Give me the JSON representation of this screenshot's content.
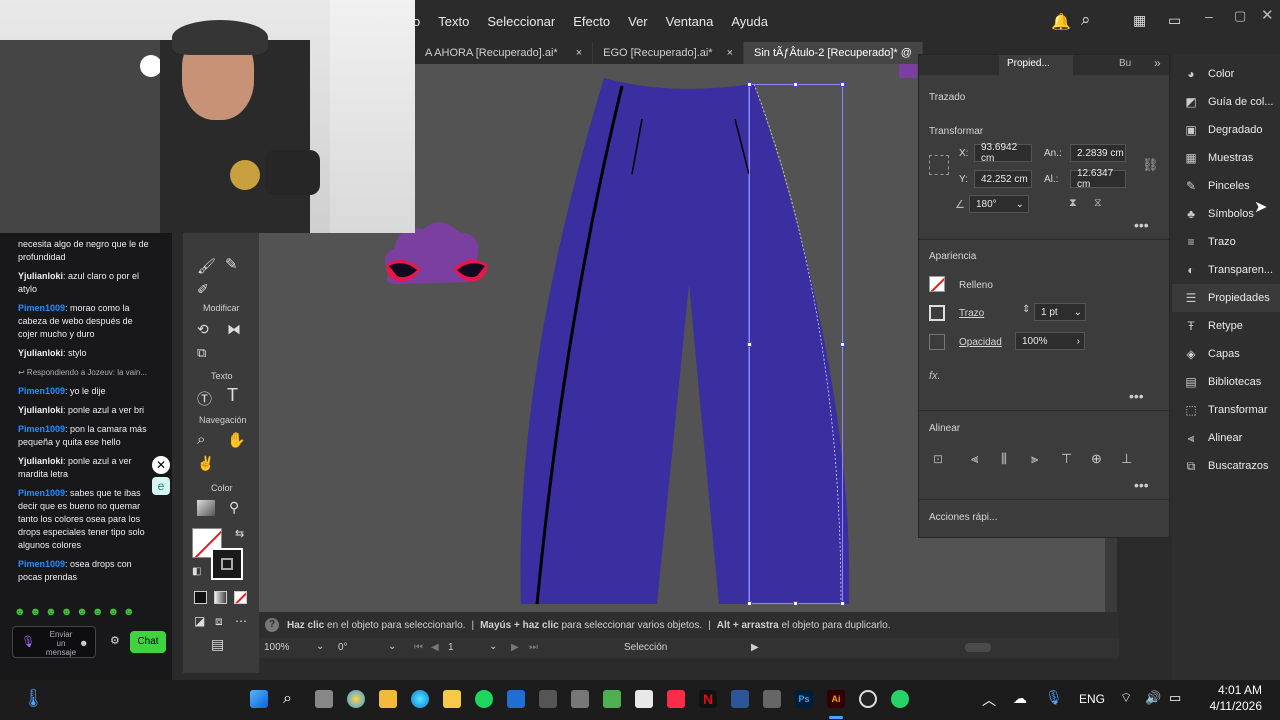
{
  "menu": [
    "o",
    "Texto",
    "Seleccionar",
    "Efecto",
    "Ver",
    "Ventana",
    "Ayuda"
  ],
  "tabs": [
    {
      "label": "A AHORA [Recuperado].ai*",
      "close": "×"
    },
    {
      "label": "EGO [Recuperado].ai*",
      "close": "×"
    },
    {
      "label": "Sin tÃƒÂtulo-2 [Recuperado]* @",
      "close": ""
    }
  ],
  "chat": {
    "messages": [
      {
        "user": "",
        "text": "necesita algo de negro que le de profundidad"
      },
      {
        "user": "Yjulianloki",
        "text": ": azul claro o por el atylo"
      },
      {
        "user": "Pimen1009",
        "text": ": morao como la cabeza de webo después de cojer mucho y duro"
      },
      {
        "user": "Yjulianloki",
        "text": ": stylo"
      },
      {
        "user": "",
        "text": "↩ Respondiendo a Jozeuv: la vain..."
      },
      {
        "user": "Pimen1009",
        "text": ": yo le dije"
      },
      {
        "user": "Yjulianloki",
        "text": ": ponle azul a ver bri"
      },
      {
        "user": "Pimen1009",
        "text": ": pon la camara más pequeña y quita ese hello"
      },
      {
        "user": "Yjulianloki",
        "text": ": ponle azul a ver mardita letra"
      },
      {
        "user": "Pimen1009",
        "text": ": sabes que te ibas decir que es bueno no quemar tanto los colores osea para los drops especiales tener tipo solo algunos colores"
      },
      {
        "user": "Pimen1009",
        "text": ": osea drops con pocas prendas"
      }
    ],
    "input_placeholder": "Enviar un mensaje",
    "chat_button": "Chat"
  },
  "tools": {
    "sections": [
      "Modificar",
      "Texto",
      "Navegación",
      "Color"
    ]
  },
  "properties": {
    "tab_label": "Propied...",
    "tab_bu": "Bu",
    "section_trazado": "Trazado",
    "section_transformar": "Transformar",
    "x_label": "X:",
    "x_value": "93.6942 cm",
    "y_label": "Y:",
    "y_value": "42.252 cm",
    "w_label": "An.:",
    "w_value": "2.2839 cm",
    "h_label": "Al.:",
    "h_value": "12.6347 cm",
    "angle_value": "180°",
    "section_apariencia": "Apariencia",
    "relleno": "Relleno",
    "trazo": "Trazo",
    "trazo_value": "1 pt",
    "opacidad": "Opacidad",
    "opacidad_value": "100%",
    "fx": "fx.",
    "section_alinear": "Alinear",
    "acciones": "Acciones rápi..."
  },
  "right_panel": [
    {
      "label": "Color",
      "icon": "palette-icon"
    },
    {
      "label": "Guía de col...",
      "icon": "color-guide-icon"
    },
    {
      "label": "Degradado",
      "icon": "gradient-icon"
    },
    {
      "label": "Muestras",
      "icon": "swatches-icon"
    },
    {
      "label": "Pinceles",
      "icon": "brush-icon"
    },
    {
      "label": "Símbolos",
      "icon": "symbols-icon"
    },
    {
      "label": "Trazo",
      "icon": "stroke-icon"
    },
    {
      "label": "Transparen...",
      "icon": "transparency-icon"
    },
    {
      "label": "Propiedades",
      "icon": "properties-icon"
    },
    {
      "label": "Retype",
      "icon": "retype-icon"
    },
    {
      "label": "Capas",
      "icon": "layers-icon"
    },
    {
      "label": "Bibliotecas",
      "icon": "libraries-icon"
    },
    {
      "label": "Transformar",
      "icon": "transform-icon"
    },
    {
      "label": "Alinear",
      "icon": "align-icon"
    },
    {
      "label": "Buscatrazos",
      "icon": "pathfinder-icon"
    }
  ],
  "hint": {
    "p1b": "Haz clic",
    "p1": " en el objeto para seleccionarlo.",
    "sep": "|",
    "p2b": "Mayús + haz clic",
    "p2": " para seleccionar varios objetos.",
    "p3b": "Alt + arrastra",
    "p3": " el objeto para duplicarlo."
  },
  "status": {
    "zoom": "100%",
    "rotation": "0°",
    "artboard": "1",
    "tool": "Selección"
  },
  "taskbar": {
    "lang": "ENG",
    "time": "4:01 AM",
    "date": "4/11/2026"
  },
  "colors": {
    "pants": "#3a2ea0",
    "pants_dark": "#30288a",
    "accent_purple": "#7b3fa0"
  }
}
